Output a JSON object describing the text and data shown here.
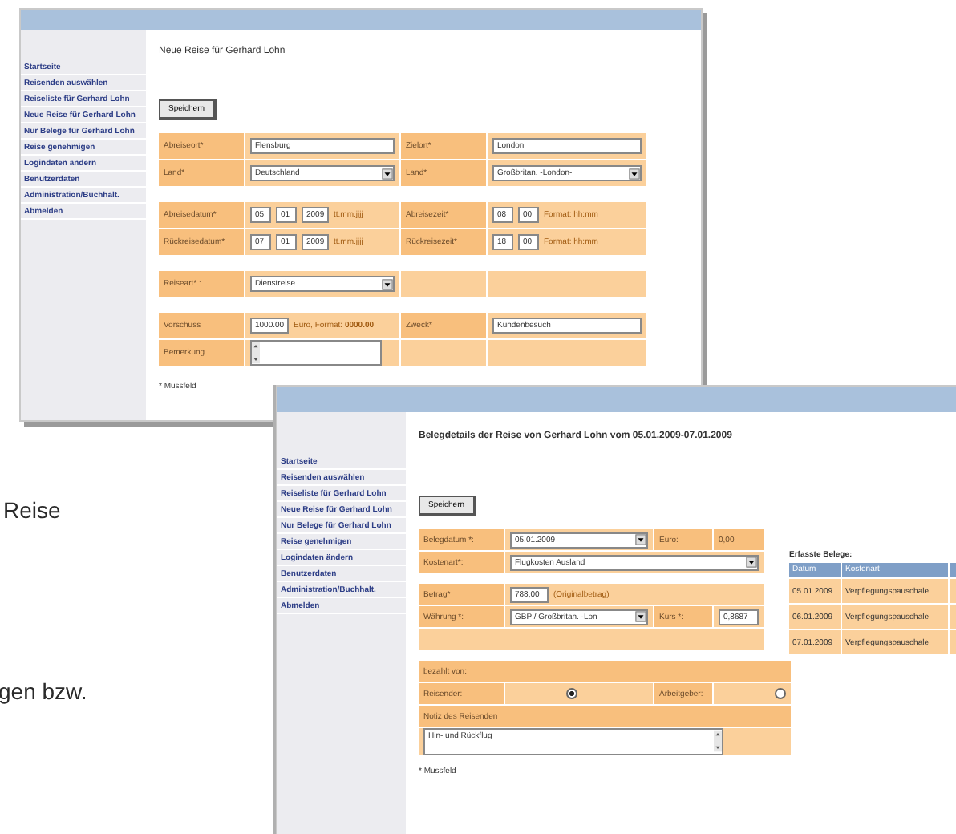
{
  "page_text": [
    {
      "text": "Reise"
    },
    {
      "text": "gen bzw."
    }
  ],
  "windows": [
    {
      "sidebar": [
        {
          "text": "Startseite"
        },
        {
          "text": "Reisenden auswählen"
        },
        {
          "text": "Reiseliste für Gerhard Lohn"
        },
        {
          "text": "Neue Reise für Gerhard Lohn"
        },
        {
          "text": "Nur Belege für Gerhard Lohn"
        },
        {
          "text": "Reise genehmigen"
        },
        {
          "text": "Logindaten ändern"
        },
        {
          "text": "Benutzerdaten"
        },
        {
          "text": "Administration/Buchhalt."
        },
        {
          "text": "Abmelden"
        }
      ],
      "heading": "Neue Reise für Gerhard Lohn",
      "save_button": "Speichern",
      "form_blocks": [
        {
          "rows": [
            {
              "cells": [
                {
                  "kind": "label",
                  "text": "Abreiseort*"
                },
                {
                  "kind": "input",
                  "value": "Flensburg"
                },
                {
                  "kind": "label",
                  "text": "Zielort*"
                },
                {
                  "kind": "input",
                  "value": "London"
                }
              ]
            },
            {
              "cells": [
                {
                  "kind": "label",
                  "text": "Land*"
                },
                {
                  "kind": "select",
                  "value": "Deutschland"
                },
                {
                  "kind": "label",
                  "text": "Land*"
                },
                {
                  "kind": "select",
                  "value": "Großbritan. -London-"
                }
              ]
            }
          ]
        },
        {
          "rows": [
            {
              "cells": [
                {
                  "kind": "label",
                  "text": "Abreisedatum*"
                },
                {
                  "kind": "date",
                  "parts": [
                    "05",
                    "01",
                    "2009"
                  ],
                  "note": "tt.mm.jjjj"
                },
                {
                  "kind": "label",
                  "text": "Abreisezeit*"
                },
                {
                  "kind": "date",
                  "parts": [
                    "08",
                    "00"
                  ],
                  "note": "Format: hh:mm"
                }
              ]
            },
            {
              "cells": [
                {
                  "kind": "label",
                  "text": "Rückreisedatum*"
                },
                {
                  "kind": "date",
                  "parts": [
                    "07",
                    "01",
                    "2009"
                  ],
                  "note": "tt.mm.jjjj"
                },
                {
                  "kind": "label",
                  "text": "Rückreisezeit*"
                },
                {
                  "kind": "date",
                  "parts": [
                    "18",
                    "00"
                  ],
                  "note": "Format: hh:mm"
                }
              ]
            }
          ]
        },
        {
          "rows": [
            {
              "cells": [
                {
                  "kind": "label",
                  "text": "Reiseart* :"
                },
                {
                  "kind": "select",
                  "value": "Dienstreise"
                },
                {
                  "kind": "empty"
                },
                {
                  "kind": "empty"
                }
              ]
            }
          ]
        },
        {
          "rows": [
            {
              "cells": [
                {
                  "kind": "label",
                  "text": "Vorschuss"
                },
                {
                  "kind": "input",
                  "value": "1000.00",
                  "note": "Euro, Format: **0000.00**"
                },
                {
                  "kind": "label",
                  "text": "Zweck*"
                },
                {
                  "kind": "input",
                  "value": "Kundenbesuch"
                }
              ]
            },
            {
              "cells": [
                {
                  "kind": "label",
                  "text": "Bemerkung"
                },
                {
                  "kind": "textarea"
                },
                {
                  "kind": "empty"
                },
                {
                  "kind": "empty"
                }
              ]
            }
          ]
        }
      ],
      "footnote": "* Mussfeld"
    },
    {
      "sidebar": [
        {
          "text": "Startseite"
        },
        {
          "text": "Reisenden auswählen"
        },
        {
          "text": "Reiseliste für Gerhard Lohn"
        },
        {
          "text": "Neue Reise für Gerhard Lohn"
        },
        {
          "text": "Nur Belege für Gerhard Lohn"
        },
        {
          "text": "Reise genehmigen"
        },
        {
          "text": "Logindaten ändern"
        },
        {
          "text": "Benutzerdaten"
        },
        {
          "text": "Administration/Buchhalt."
        },
        {
          "text": "Abmelden"
        }
      ],
      "heading": "Belegdetails der Reise von Gerhard Lohn vom 05.01.2009-07.01.2009",
      "save_button": "Speichern",
      "form_blocks": [
        {
          "rows": [
            {
              "cells": [
                {
                  "kind": "label",
                  "text": "Belegdatum *:"
                },
                {
                  "kind": "select",
                  "value": "05.01.2009"
                },
                {
                  "kind": "label",
                  "text": "Euro:"
                },
                {
                  "kind": "text",
                  "text": "0,00"
                }
              ]
            },
            {
              "cells": [
                {
                  "kind": "label",
                  "text": "Kostenart*:"
                },
                {
                  "kind": "select",
                  "value": "Flugkosten Ausland",
                  "wide": true
                }
              ]
            }
          ]
        },
        {
          "rows": [
            {
              "cells": [
                {
                  "kind": "label",
                  "text": "Betrag*"
                },
                {
                  "kind": "input",
                  "value": "788,00",
                  "note": "(Originalbetrag)",
                  "wide": true
                }
              ]
            },
            {
              "cells": [
                {
                  "kind": "label",
                  "text": "Währung *:"
                },
                {
                  "kind": "select",
                  "value": "GBP / Großbritan. -Lon"
                },
                {
                  "kind": "label",
                  "text": "Kurs *:"
                },
                {
                  "kind": "input",
                  "value": "0,8687"
                }
              ]
            },
            {
              "cells": [
                {
                  "kind": "empty",
                  "wide": true
                }
              ]
            }
          ]
        },
        {
          "rows": [
            {
              "cells": [
                {
                  "kind": "label",
                  "text": "bezahlt von:",
                  "wide": true
                }
              ]
            },
            {
              "cells": [
                {
                  "kind": "label",
                  "text": "Reisender:"
                },
                {
                  "kind": "radio",
                  "selected": true
                },
                {
                  "kind": "label",
                  "text": "Arbeitgeber:"
                },
                {
                  "kind": "radio",
                  "selected": false
                }
              ]
            },
            {
              "cells": [
                {
                  "kind": "label",
                  "text": "Notiz des Reisenden",
                  "wide": true
                }
              ]
            },
            {
              "cells": [
                {
                  "kind": "textarea",
                  "value": "Hin- und Rückflug",
                  "wide": true
                }
              ]
            }
          ]
        }
      ],
      "footnote": "* Mussfeld",
      "receipts": {
        "title": "Erfasste Belege:",
        "columns": [
          "Datum",
          "Kostenart"
        ],
        "rows": [
          [
            "05.01.2009",
            "Verpflegungspauschale"
          ],
          [
            "06.01.2009",
            "Verpflegungspauschale"
          ],
          [
            "07.01.2009",
            "Verpflegungspauschale"
          ]
        ]
      }
    }
  ]
}
